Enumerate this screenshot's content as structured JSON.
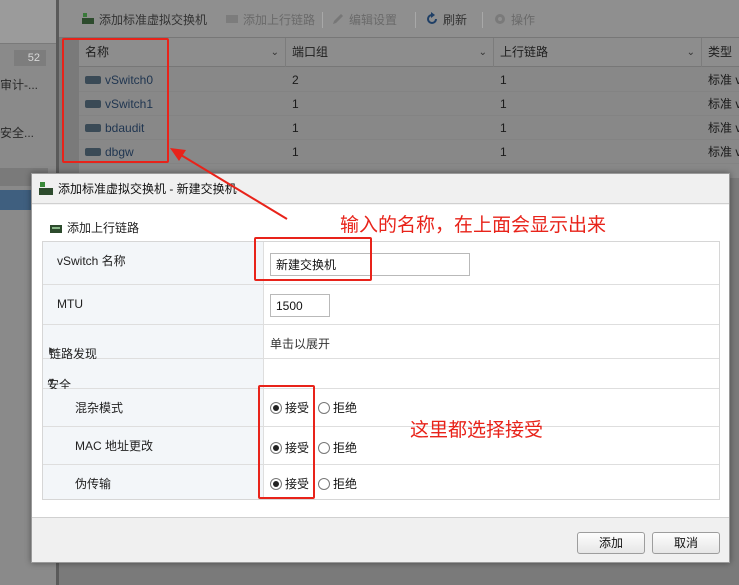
{
  "background": {
    "badge_count": "52",
    "left_text_1": "审计-...",
    "left_text_2": "安全..."
  },
  "toolbar": {
    "add_vswitch": "添加标准虚拟交换机",
    "add_uplink": "添加上行链路",
    "edit_settings": "编辑设置",
    "refresh": "刷新",
    "actions": "操作"
  },
  "grid": {
    "columns": [
      "名称",
      "端口组",
      "上行链路",
      "类型"
    ],
    "rows": [
      {
        "name": "vSwitch0",
        "port_groups": "2",
        "uplinks": "1",
        "type": "标准 v"
      },
      {
        "name": "vSwitch1",
        "port_groups": "1",
        "uplinks": "1",
        "type": "标准 v"
      },
      {
        "name": "bdaudit",
        "port_groups": "1",
        "uplinks": "1",
        "type": "标准 v"
      },
      {
        "name": "dbgw",
        "port_groups": "1",
        "uplinks": "1",
        "type": "标准 v"
      }
    ]
  },
  "dialog": {
    "title": "添加标准虚拟交换机 - 新建交换机",
    "add_uplink": "添加上行链路",
    "fields": {
      "vswitch_name_label": "vSwitch 名称",
      "vswitch_name_value": "新建交换机",
      "mtu_label": "MTU",
      "mtu_value": "1500",
      "link_discovery_label": "链路发现",
      "link_discovery_value": "单击以展开",
      "security_label": "安全",
      "promiscuous_label": "混杂模式",
      "mac_change_label": "MAC 地址更改",
      "forged_label": "伪传输",
      "accept": "接受",
      "reject": "拒绝"
    },
    "buttons": {
      "add": "添加",
      "cancel": "取消"
    }
  },
  "annotations": {
    "name_note": "输入的名称，在上面会显示出来",
    "accept_note": "这里都选择接受",
    "color": "#e8231a"
  }
}
